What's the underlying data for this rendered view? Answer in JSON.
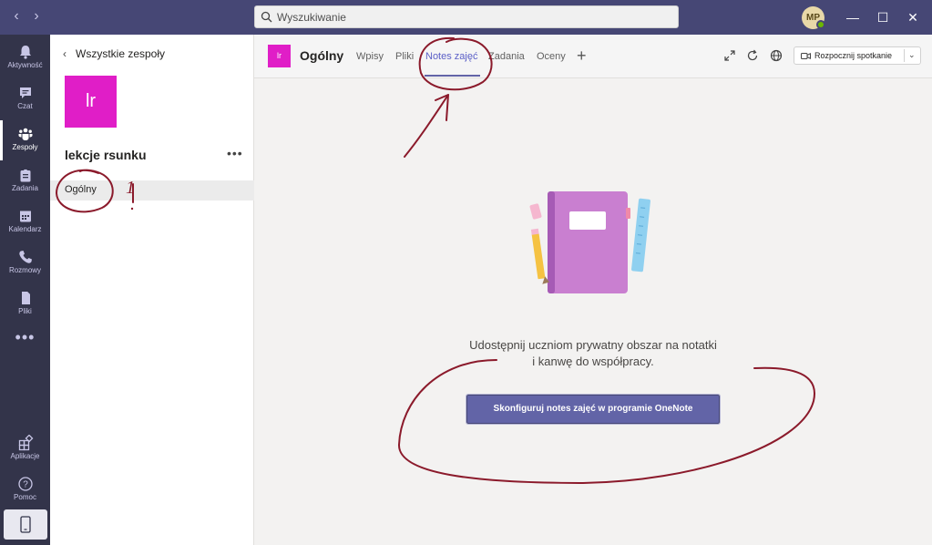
{
  "search": {
    "placeholder": "Wyszukiwanie"
  },
  "user": {
    "initials": "MP"
  },
  "rail": {
    "items": [
      {
        "label": "Aktywność",
        "icon": "bell-icon"
      },
      {
        "label": "Czat",
        "icon": "chat-icon"
      },
      {
        "label": "Zespoły",
        "icon": "teams-icon",
        "active": true
      },
      {
        "label": "Zadania",
        "icon": "assignments-icon"
      },
      {
        "label": "Kalendarz",
        "icon": "calendar-icon"
      },
      {
        "label": "Rozmowy",
        "icon": "phone-icon"
      },
      {
        "label": "Pliki",
        "icon": "files-icon"
      },
      {
        "label": "Aplikacje",
        "icon": "apps-icon"
      },
      {
        "label": "Pomoc",
        "icon": "help-icon"
      }
    ]
  },
  "teampanel": {
    "back_label": "Wszystkie zespoły",
    "team_initials": "lr",
    "team_name": "lekcje rsunku",
    "channel": "Ogólny"
  },
  "header": {
    "channel_initials": "lr",
    "channel_title": "Ogólny",
    "tabs": [
      {
        "label": "Wpisy"
      },
      {
        "label": "Pliki"
      },
      {
        "label": "Notes zajęć",
        "active": true
      },
      {
        "label": "Zadania"
      },
      {
        "label": "Oceny"
      }
    ],
    "meet_label": "Rozpocznij spotkanie"
  },
  "content": {
    "line1": "Udostępnij uczniom prywatny obszar na notatki",
    "line2": "i kanwę do współpracy.",
    "cta_label": "Skonfiguruj notes zajęć w programie OneNote"
  },
  "annotations": {
    "number": "1"
  },
  "colors": {
    "titlebar": "#464775",
    "rail": "#33344a",
    "brand": "#6264a7",
    "team_tile": "#e01ec7",
    "notebook": "#c97fd0",
    "annotation_ink": "#8b1a2b"
  }
}
